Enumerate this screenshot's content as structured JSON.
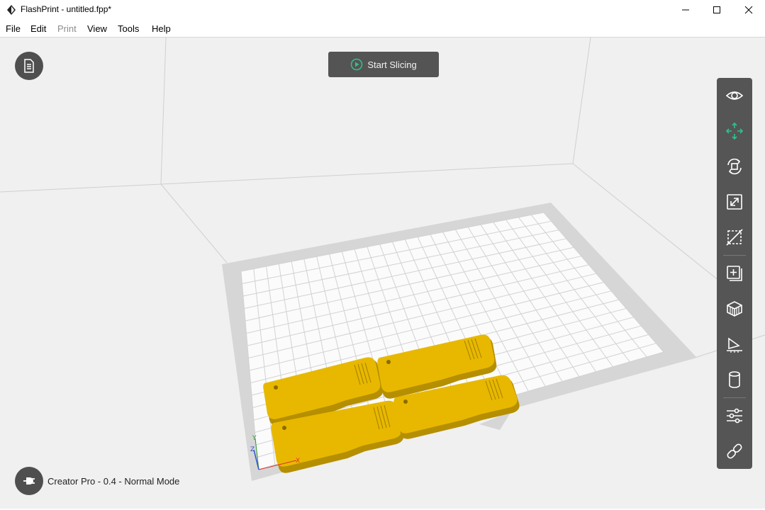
{
  "window": {
    "title": "FlashPrint - untitled.fpp*"
  },
  "menu": {
    "items": [
      {
        "label": "File",
        "enabled": true
      },
      {
        "label": "Edit",
        "enabled": true
      },
      {
        "label": "Print",
        "enabled": false
      },
      {
        "label": "View",
        "enabled": true
      },
      {
        "label": "Tools",
        "enabled": true
      },
      {
        "label": "Help",
        "enabled": true
      }
    ]
  },
  "viewport": {
    "slice_button_label": "Start Slicing",
    "axis_labels": {
      "x": "X",
      "y": "Y",
      "z": "Z"
    },
    "model_color": "#e8b800",
    "accent_color": "#2ec28c"
  },
  "toolbar": {
    "tools": [
      {
        "name": "view",
        "icon": "eye-icon",
        "active": false
      },
      {
        "name": "move",
        "icon": "move-arrows-icon",
        "active": true
      },
      {
        "name": "rotate",
        "icon": "rotate-icon",
        "active": false
      },
      {
        "name": "scale",
        "icon": "scale-icon",
        "active": false
      },
      {
        "name": "cut",
        "icon": "cut-icon",
        "active": false
      },
      {
        "name": "add-model",
        "icon": "add-model-icon",
        "active": false
      },
      {
        "name": "supports",
        "icon": "supports-icon",
        "active": false
      },
      {
        "name": "lay-on-face",
        "icon": "lay-flat-icon",
        "active": false
      },
      {
        "name": "shell",
        "icon": "cylinder-icon",
        "active": false
      },
      {
        "name": "settings",
        "icon": "sliders-icon",
        "active": false
      },
      {
        "name": "link",
        "icon": "link-icon",
        "active": false
      }
    ]
  },
  "status": {
    "text": "Creator Pro - 0.4 - Normal Mode"
  }
}
